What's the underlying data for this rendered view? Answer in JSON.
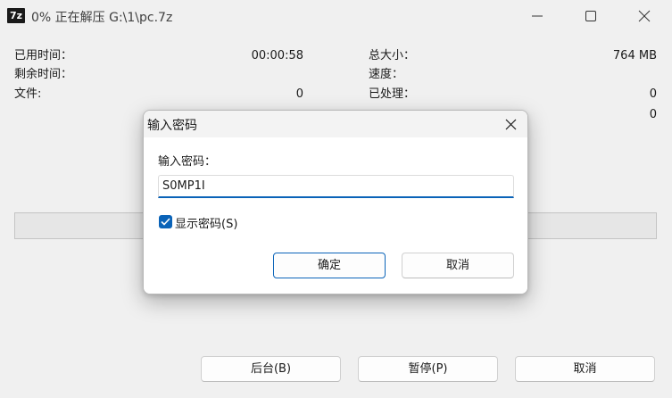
{
  "window": {
    "icon_text": "7z",
    "title": "0% 正在解压 G:\\1\\pc.7z"
  },
  "stats": {
    "elapsed_label": "已用时间：",
    "elapsed_value": "00:00:58",
    "remaining_label": "剩余时间：",
    "files_label": "文件:",
    "files_value": "0",
    "total_size_label": "总大小：",
    "total_size_value": "764 MB",
    "speed_label": "速度：",
    "processed_label": "已处理：",
    "processed_value": "0",
    "extra_value": "0",
    "progress_fraction": 0
  },
  "buttons": {
    "background": "后台(B)",
    "pause": "暂停(P)",
    "cancel": "取消"
  },
  "dialog": {
    "title": "输入密码",
    "password_label": "输入密码：",
    "password_value": "S0MP1I",
    "show_password_label": "显示密码(S)",
    "show_password_checked": true,
    "ok_label": "确定",
    "cancel_label": "取消"
  },
  "colors": {
    "accent": "#0a63b8",
    "window_bg": "#f0f0f0",
    "dialog_body_bg": "#ffffff"
  }
}
